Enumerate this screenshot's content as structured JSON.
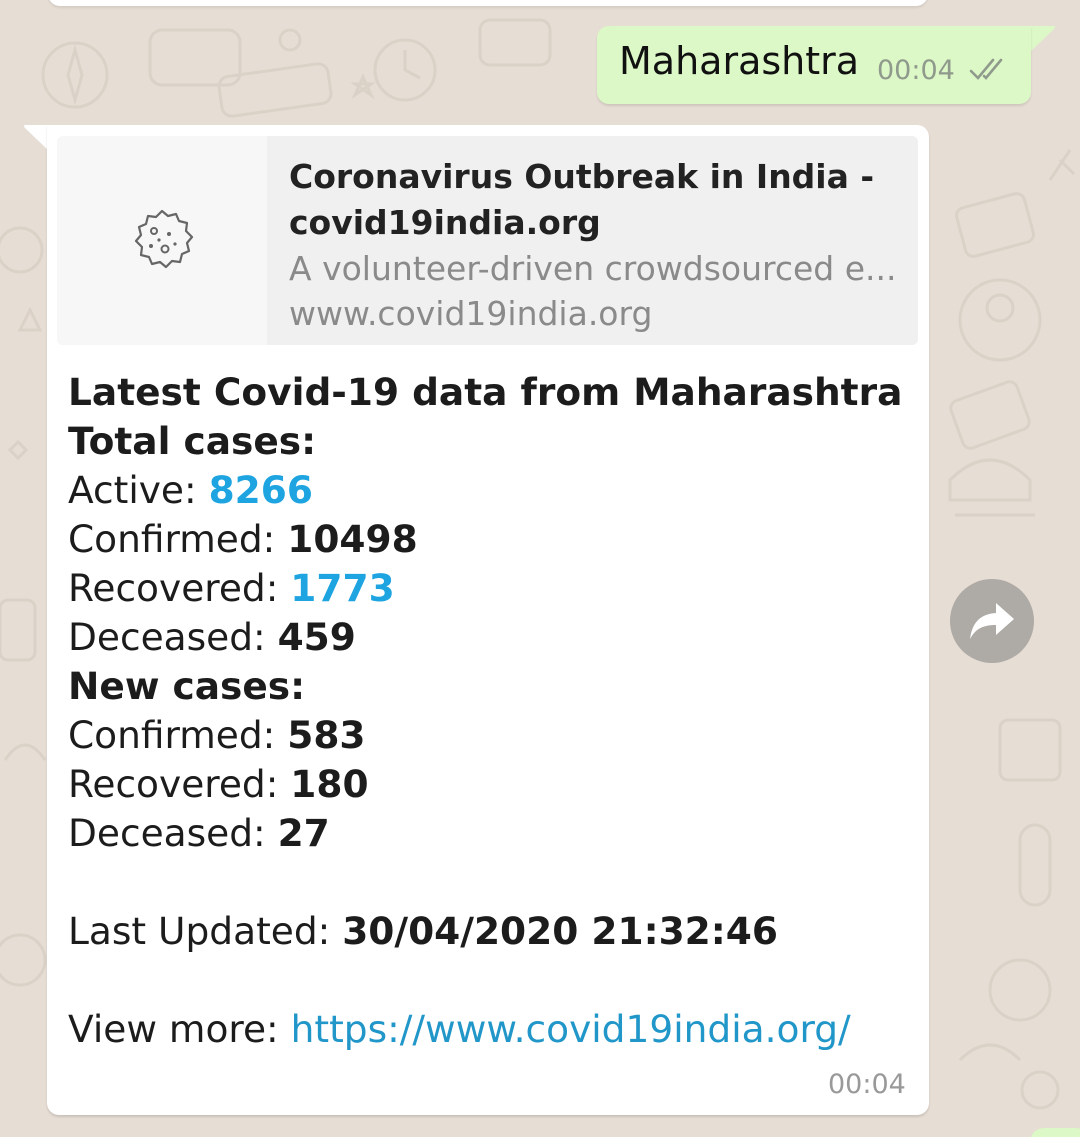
{
  "outgoing": {
    "text": "Maharashtra",
    "time": "00:04",
    "status_icon": "double-check-icon"
  },
  "incoming": {
    "link_preview": {
      "title": "Coronavirus Outbreak in India - covid19india.org",
      "description": "A volunteer-driven crowdsourced e...",
      "url": "www.covid19india.org",
      "thumbnail_icon": "virus-icon"
    },
    "heading": "Latest Covid-19 data from Maharashtra",
    "total_label": "Total cases:",
    "total": {
      "active_label": "Active: ",
      "active": "8266",
      "confirmed_label": "Confirmed: ",
      "confirmed": "10498",
      "recovered_label": "Recovered: ",
      "recovered": "1773",
      "deceased_label": "Deceased: ",
      "deceased": "459"
    },
    "new_label": "New cases:",
    "new": {
      "confirmed_label": "Confirmed: ",
      "confirmed": "583",
      "recovered_label": "Recovered: ",
      "recovered": "180",
      "deceased_label": "Deceased: ",
      "deceased": "27"
    },
    "updated_label": "Last Updated: ",
    "updated": "30/04/2020 21:32:46",
    "more_label": "View more: ",
    "more_link": "https://www.covid19india.org/",
    "time": "00:04"
  },
  "forward_icon": "forward-icon",
  "colors": {
    "chat_bg": "#e6ddd4",
    "outgoing_bubble": "#dcf8c6",
    "incoming_bubble": "#ffffff",
    "highlight_blue": "#1ea4e0",
    "link": "#2196c9"
  }
}
